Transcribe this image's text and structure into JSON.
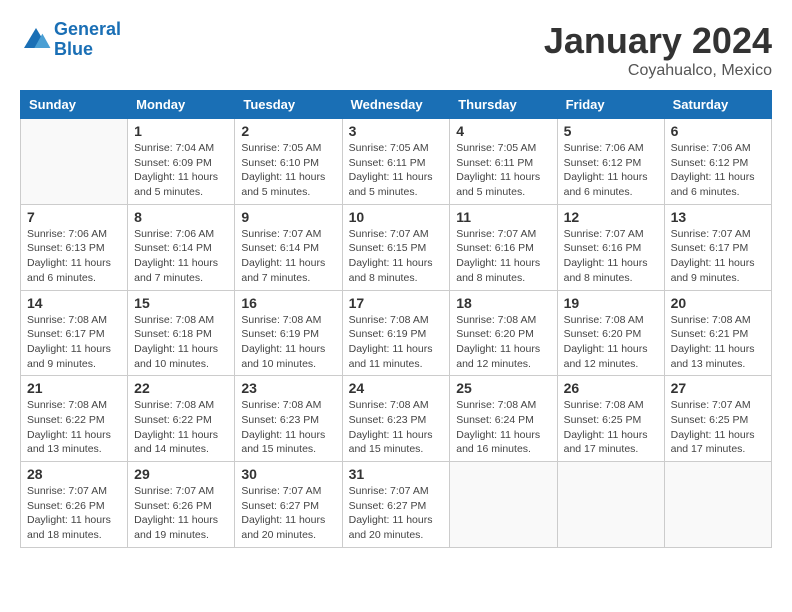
{
  "header": {
    "logo_line1": "General",
    "logo_line2": "Blue",
    "month_title": "January 2024",
    "location": "Coyahualco, Mexico"
  },
  "weekdays": [
    "Sunday",
    "Monday",
    "Tuesday",
    "Wednesday",
    "Thursday",
    "Friday",
    "Saturday"
  ],
  "weeks": [
    [
      {
        "day": "",
        "info": ""
      },
      {
        "day": "1",
        "info": "Sunrise: 7:04 AM\nSunset: 6:09 PM\nDaylight: 11 hours\nand 5 minutes."
      },
      {
        "day": "2",
        "info": "Sunrise: 7:05 AM\nSunset: 6:10 PM\nDaylight: 11 hours\nand 5 minutes."
      },
      {
        "day": "3",
        "info": "Sunrise: 7:05 AM\nSunset: 6:11 PM\nDaylight: 11 hours\nand 5 minutes."
      },
      {
        "day": "4",
        "info": "Sunrise: 7:05 AM\nSunset: 6:11 PM\nDaylight: 11 hours\nand 5 minutes."
      },
      {
        "day": "5",
        "info": "Sunrise: 7:06 AM\nSunset: 6:12 PM\nDaylight: 11 hours\nand 6 minutes."
      },
      {
        "day": "6",
        "info": "Sunrise: 7:06 AM\nSunset: 6:12 PM\nDaylight: 11 hours\nand 6 minutes."
      }
    ],
    [
      {
        "day": "7",
        "info": "Sunrise: 7:06 AM\nSunset: 6:13 PM\nDaylight: 11 hours\nand 6 minutes."
      },
      {
        "day": "8",
        "info": "Sunrise: 7:06 AM\nSunset: 6:14 PM\nDaylight: 11 hours\nand 7 minutes."
      },
      {
        "day": "9",
        "info": "Sunrise: 7:07 AM\nSunset: 6:14 PM\nDaylight: 11 hours\nand 7 minutes."
      },
      {
        "day": "10",
        "info": "Sunrise: 7:07 AM\nSunset: 6:15 PM\nDaylight: 11 hours\nand 8 minutes."
      },
      {
        "day": "11",
        "info": "Sunrise: 7:07 AM\nSunset: 6:16 PM\nDaylight: 11 hours\nand 8 minutes."
      },
      {
        "day": "12",
        "info": "Sunrise: 7:07 AM\nSunset: 6:16 PM\nDaylight: 11 hours\nand 8 minutes."
      },
      {
        "day": "13",
        "info": "Sunrise: 7:07 AM\nSunset: 6:17 PM\nDaylight: 11 hours\nand 9 minutes."
      }
    ],
    [
      {
        "day": "14",
        "info": "Sunrise: 7:08 AM\nSunset: 6:17 PM\nDaylight: 11 hours\nand 9 minutes."
      },
      {
        "day": "15",
        "info": "Sunrise: 7:08 AM\nSunset: 6:18 PM\nDaylight: 11 hours\nand 10 minutes."
      },
      {
        "day": "16",
        "info": "Sunrise: 7:08 AM\nSunset: 6:19 PM\nDaylight: 11 hours\nand 10 minutes."
      },
      {
        "day": "17",
        "info": "Sunrise: 7:08 AM\nSunset: 6:19 PM\nDaylight: 11 hours\nand 11 minutes."
      },
      {
        "day": "18",
        "info": "Sunrise: 7:08 AM\nSunset: 6:20 PM\nDaylight: 11 hours\nand 12 minutes."
      },
      {
        "day": "19",
        "info": "Sunrise: 7:08 AM\nSunset: 6:20 PM\nDaylight: 11 hours\nand 12 minutes."
      },
      {
        "day": "20",
        "info": "Sunrise: 7:08 AM\nSunset: 6:21 PM\nDaylight: 11 hours\nand 13 minutes."
      }
    ],
    [
      {
        "day": "21",
        "info": "Sunrise: 7:08 AM\nSunset: 6:22 PM\nDaylight: 11 hours\nand 13 minutes."
      },
      {
        "day": "22",
        "info": "Sunrise: 7:08 AM\nSunset: 6:22 PM\nDaylight: 11 hours\nand 14 minutes."
      },
      {
        "day": "23",
        "info": "Sunrise: 7:08 AM\nSunset: 6:23 PM\nDaylight: 11 hours\nand 15 minutes."
      },
      {
        "day": "24",
        "info": "Sunrise: 7:08 AM\nSunset: 6:23 PM\nDaylight: 11 hours\nand 15 minutes."
      },
      {
        "day": "25",
        "info": "Sunrise: 7:08 AM\nSunset: 6:24 PM\nDaylight: 11 hours\nand 16 minutes."
      },
      {
        "day": "26",
        "info": "Sunrise: 7:08 AM\nSunset: 6:25 PM\nDaylight: 11 hours\nand 17 minutes."
      },
      {
        "day": "27",
        "info": "Sunrise: 7:07 AM\nSunset: 6:25 PM\nDaylight: 11 hours\nand 17 minutes."
      }
    ],
    [
      {
        "day": "28",
        "info": "Sunrise: 7:07 AM\nSunset: 6:26 PM\nDaylight: 11 hours\nand 18 minutes."
      },
      {
        "day": "29",
        "info": "Sunrise: 7:07 AM\nSunset: 6:26 PM\nDaylight: 11 hours\nand 19 minutes."
      },
      {
        "day": "30",
        "info": "Sunrise: 7:07 AM\nSunset: 6:27 PM\nDaylight: 11 hours\nand 20 minutes."
      },
      {
        "day": "31",
        "info": "Sunrise: 7:07 AM\nSunset: 6:27 PM\nDaylight: 11 hours\nand 20 minutes."
      },
      {
        "day": "",
        "info": ""
      },
      {
        "day": "",
        "info": ""
      },
      {
        "day": "",
        "info": ""
      }
    ]
  ]
}
